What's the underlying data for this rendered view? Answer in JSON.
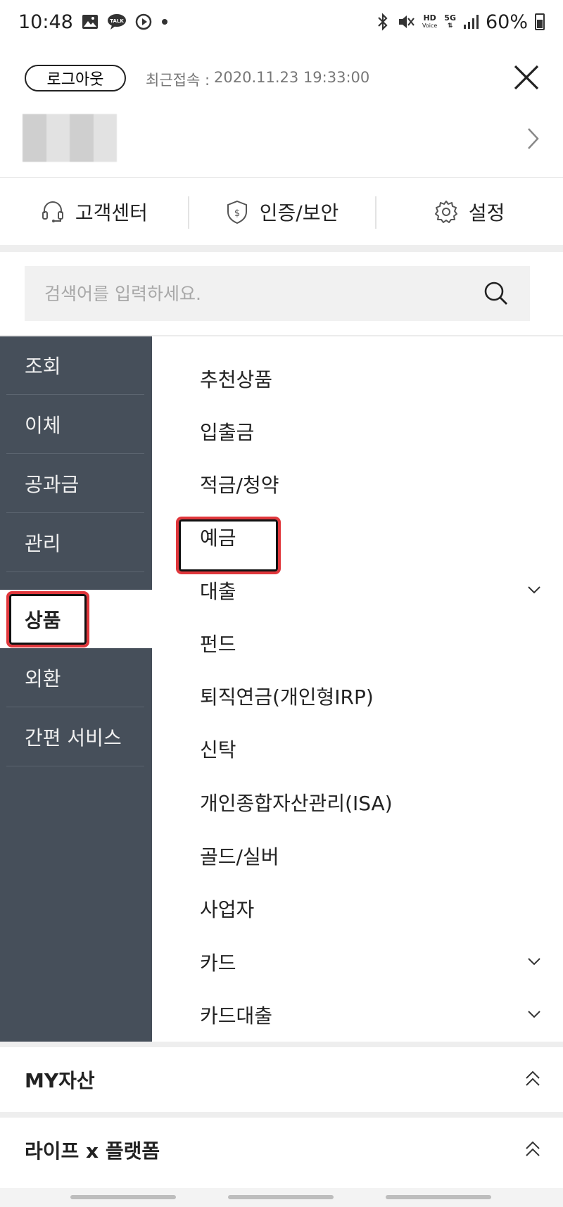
{
  "status_bar": {
    "time": "10:48",
    "battery": "60%",
    "icons": [
      "image-icon",
      "talk-icon",
      "play-icon",
      "dot-icon",
      "bluetooth-icon",
      "mute-icon",
      "hd-voice-icon",
      "5g-icon",
      "signal-icon",
      "battery-icon"
    ],
    "talk_label": "TALK",
    "hd_label": "HD",
    "voice_label": "Voice",
    "fiveg_label": "5G"
  },
  "header": {
    "logout_label": "로그아웃",
    "last_login_label": "최근접속 :",
    "last_login_value": "2020.11.23 19:33:00"
  },
  "quick_links": [
    {
      "label": "고객센터",
      "icon": "headset-icon"
    },
    {
      "label": "인증/보안",
      "icon": "shield-icon"
    },
    {
      "label": "설정",
      "icon": "gear-icon"
    }
  ],
  "search": {
    "placeholder": "검색어를 입력하세요."
  },
  "left_nav": {
    "items": [
      {
        "label": "조회"
      },
      {
        "label": "이체"
      },
      {
        "label": "공과금"
      },
      {
        "label": "관리"
      },
      {
        "label": "상품"
      },
      {
        "label": "외환"
      },
      {
        "label": "간편 서비스"
      }
    ],
    "active": "상품"
  },
  "right_menu": {
    "items": [
      {
        "label": "추천상품",
        "expandable": false
      },
      {
        "label": "입출금",
        "expandable": false
      },
      {
        "label": "적금/청약",
        "expandable": false
      },
      {
        "label": "예금",
        "expandable": false
      },
      {
        "label": "대출",
        "expandable": true
      },
      {
        "label": "펀드",
        "expandable": false
      },
      {
        "label": "퇴직연금(개인형IRP)",
        "expandable": false
      },
      {
        "label": "신탁",
        "expandable": false
      },
      {
        "label": "개인종합자산관리(ISA)",
        "expandable": false
      },
      {
        "label": "골드/실버",
        "expandable": false
      },
      {
        "label": "사업자",
        "expandable": false
      },
      {
        "label": "카드",
        "expandable": true
      },
      {
        "label": "카드대출",
        "expandable": true
      }
    ]
  },
  "sections": [
    {
      "label": "MY자산"
    },
    {
      "label": "라이프 x 플랫폼"
    }
  ],
  "colors": {
    "left_nav_bg": "#464f5a",
    "highlight": "#e0373c",
    "search_bg": "#f1f1f1"
  }
}
